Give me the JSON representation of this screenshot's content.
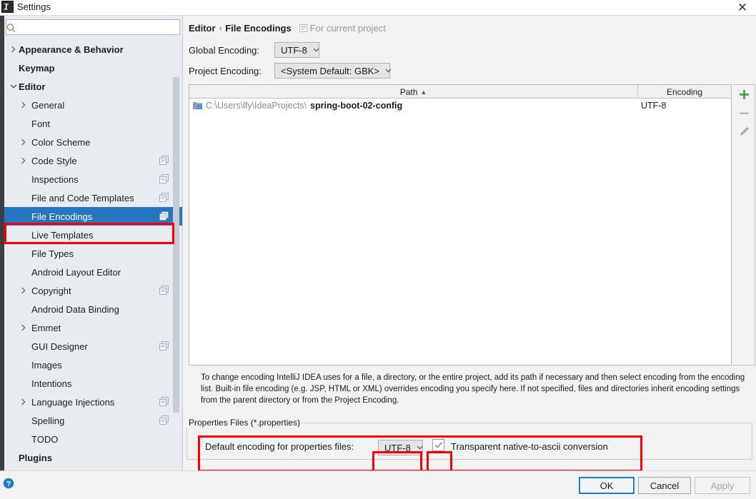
{
  "window": {
    "title": "Settings",
    "app_icon": "intellij-idea-icon",
    "close_label": "✕"
  },
  "sidebar": {
    "search": {
      "placeholder": "",
      "value": "",
      "icon": "search-icon"
    },
    "items": [
      {
        "label": "Appearance & Behavior",
        "level": 0,
        "expandable": true,
        "expanded": false,
        "bold": true,
        "copy": false,
        "selected": false
      },
      {
        "label": "Keymap",
        "level": 0,
        "expandable": false,
        "expanded": false,
        "bold": true,
        "copy": false,
        "selected": false
      },
      {
        "label": "Editor",
        "level": 0,
        "expandable": true,
        "expanded": true,
        "bold": true,
        "copy": false,
        "selected": false
      },
      {
        "label": "General",
        "level": 1,
        "expandable": true,
        "expanded": false,
        "bold": false,
        "copy": false,
        "selected": false
      },
      {
        "label": "Font",
        "level": 1,
        "expandable": false,
        "expanded": false,
        "bold": false,
        "copy": false,
        "selected": false
      },
      {
        "label": "Color Scheme",
        "level": 1,
        "expandable": true,
        "expanded": false,
        "bold": false,
        "copy": false,
        "selected": false
      },
      {
        "label": "Code Style",
        "level": 1,
        "expandable": true,
        "expanded": false,
        "bold": false,
        "copy": true,
        "selected": false
      },
      {
        "label": "Inspections",
        "level": 1,
        "expandable": false,
        "expanded": false,
        "bold": false,
        "copy": true,
        "selected": false
      },
      {
        "label": "File and Code Templates",
        "level": 1,
        "expandable": false,
        "expanded": false,
        "bold": false,
        "copy": true,
        "selected": false
      },
      {
        "label": "File Encodings",
        "level": 1,
        "expandable": false,
        "expanded": false,
        "bold": false,
        "copy": true,
        "selected": true
      },
      {
        "label": "Live Templates",
        "level": 1,
        "expandable": false,
        "expanded": false,
        "bold": false,
        "copy": false,
        "selected": false
      },
      {
        "label": "File Types",
        "level": 1,
        "expandable": false,
        "expanded": false,
        "bold": false,
        "copy": false,
        "selected": false
      },
      {
        "label": "Android Layout Editor",
        "level": 1,
        "expandable": false,
        "expanded": false,
        "bold": false,
        "copy": false,
        "selected": false
      },
      {
        "label": "Copyright",
        "level": 1,
        "expandable": true,
        "expanded": false,
        "bold": false,
        "copy": true,
        "selected": false
      },
      {
        "label": "Android Data Binding",
        "level": 1,
        "expandable": false,
        "expanded": false,
        "bold": false,
        "copy": false,
        "selected": false
      },
      {
        "label": "Emmet",
        "level": 1,
        "expandable": true,
        "expanded": false,
        "bold": false,
        "copy": false,
        "selected": false
      },
      {
        "label": "GUI Designer",
        "level": 1,
        "expandable": false,
        "expanded": false,
        "bold": false,
        "copy": true,
        "selected": false
      },
      {
        "label": "Images",
        "level": 1,
        "expandable": false,
        "expanded": false,
        "bold": false,
        "copy": false,
        "selected": false
      },
      {
        "label": "Intentions",
        "level": 1,
        "expandable": false,
        "expanded": false,
        "bold": false,
        "copy": false,
        "selected": false
      },
      {
        "label": "Language Injections",
        "level": 1,
        "expandable": true,
        "expanded": false,
        "bold": false,
        "copy": true,
        "selected": false
      },
      {
        "label": "Spelling",
        "level": 1,
        "expandable": false,
        "expanded": false,
        "bold": false,
        "copy": true,
        "selected": false
      },
      {
        "label": "TODO",
        "level": 1,
        "expandable": false,
        "expanded": false,
        "bold": false,
        "copy": false,
        "selected": false
      },
      {
        "label": "Plugins",
        "level": 0,
        "expandable": false,
        "expanded": false,
        "bold": true,
        "copy": false,
        "selected": false
      }
    ]
  },
  "content": {
    "breadcrumb": {
      "parent": "Editor",
      "separator": "›",
      "current": "File Encodings",
      "scope_note": "For current project",
      "scope_icon": "project-scope-icon"
    },
    "global_encoding": {
      "label": "Global Encoding:",
      "value": "UTF-8"
    },
    "project_encoding": {
      "label": "Project Encoding:",
      "value": "<System Default: GBK>"
    },
    "table": {
      "columns": [
        "Path",
        "Encoding"
      ],
      "sort_column": "Path",
      "sort_direction": "asc",
      "sort_glyph": "▲",
      "rows": [
        {
          "icon": "module-folder-icon",
          "path_prefix": "C:\\Users\\lfy\\IdeaProjects\\",
          "path_name": "spring-boot-02-config",
          "encoding": "UTF-8"
        }
      ],
      "toolbar": [
        {
          "name": "add-button",
          "glyph": "+"
        },
        {
          "name": "remove-button",
          "glyph": "−"
        },
        {
          "name": "edit-button",
          "glyph": "✎"
        }
      ]
    },
    "description": "To change encoding IntelliJ IDEA uses for a file, a directory, or the entire project, add its path if necessary and then select encoding from the encoding list. Built-in file encoding (e.g. JSP, HTML or XML) overrides encoding you specify here. If not specified, files and directories inherit encoding settings from the parent directory or from the Project Encoding.",
    "properties_group": {
      "title": "Properties Files (*.properties)",
      "default_encoding_label": "Default encoding for properties files:",
      "default_encoding_value": "UTF-8",
      "transparent_checkbox_label": "Transparent native-to-ascii conversion",
      "transparent_checkbox_checked": true,
      "check_glyph": "✓"
    }
  },
  "footer": {
    "help_icon": "help-question-icon",
    "ok_label": "OK",
    "cancel_label": "Cancel",
    "apply_label": "Apply",
    "apply_disabled": true
  },
  "annotations": {
    "color": "#fb0007",
    "boxes": [
      "sidebar-file-encodings-highlight",
      "properties-files-row-highlight",
      "default-encoding-combo-highlight",
      "transparent-checkbox-highlight"
    ]
  },
  "colors": {
    "selection_blue": "#2675bf",
    "annotation_red": "#fb0007",
    "sidebar_bg": "#e8ecf0",
    "panel_bg": "#f2f2f2",
    "focus_blue": "#1a7fd4",
    "add_green": "#3f9e3f"
  }
}
